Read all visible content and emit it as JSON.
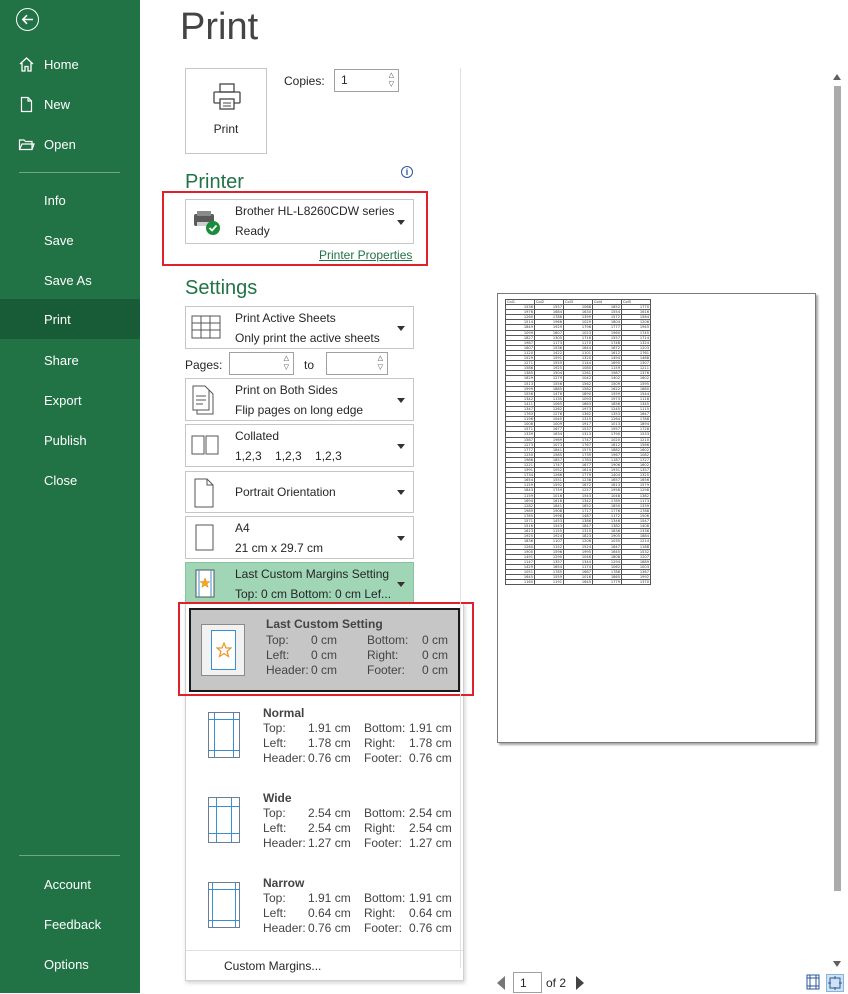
{
  "sidebar": {
    "back_label": "Back",
    "items": [
      {
        "label": "Home",
        "icon": "home-icon"
      },
      {
        "label": "New",
        "icon": "new-document-icon"
      },
      {
        "label": "Open",
        "icon": "open-folder-icon"
      },
      {
        "label": "Info"
      },
      {
        "label": "Save"
      },
      {
        "label": "Save As"
      },
      {
        "label": "Print",
        "selected": true
      },
      {
        "label": "Share"
      },
      {
        "label": "Export"
      },
      {
        "label": "Publish"
      },
      {
        "label": "Close"
      }
    ],
    "bottom_items": [
      {
        "label": "Account"
      },
      {
        "label": "Feedback"
      },
      {
        "label": "Options"
      }
    ],
    "color": "#217346",
    "selected_color": "#185c37"
  },
  "page_title": "Print",
  "print_button": {
    "label": "Print",
    "icon": "printer-icon"
  },
  "copies": {
    "label": "Copies:",
    "value": "1"
  },
  "printer": {
    "heading": "Printer",
    "name": "Brother HL-L8260CDW series",
    "status": "Ready",
    "properties_link": "Printer Properties",
    "info_icon": "info-icon"
  },
  "settings": {
    "heading": "Settings",
    "sheets": {
      "title": "Print Active Sheets",
      "subtitle": "Only print the active sheets"
    },
    "pages": {
      "label": "Pages:",
      "to_label": "to",
      "from_value": "",
      "to_value": ""
    },
    "sides": {
      "title": "Print on Both Sides",
      "subtitle": "Flip pages on long edge"
    },
    "collation": {
      "title": "Collated",
      "subtitle": "1,2,3    1,2,3    1,2,3"
    },
    "orientation": {
      "title": "Portrait Orientation"
    },
    "paper": {
      "title": "A4",
      "subtitle": "21 cm x 29.7 cm"
    },
    "margins": {
      "title": "Last Custom Margins Setting",
      "subtitle": "Top: 0 cm Bottom: 0 cm Lef..."
    }
  },
  "margins_menu": {
    "options": [
      {
        "name": "Last Custom Setting",
        "top_label": "Top:",
        "top": "0 cm",
        "bottom_label": "Bottom:",
        "bottom": "0 cm",
        "left_label": "Left:",
        "left": "0 cm",
        "right_label": "Right:",
        "right": "0 cm",
        "header_label": "Header:",
        "header": "0 cm",
        "footer_label": "Footer:",
        "footer": "0 cm",
        "selected": true
      },
      {
        "name": "Normal",
        "top_label": "Top:",
        "top": "1.91 cm",
        "bottom_label": "Bottom:",
        "bottom": "1.91 cm",
        "left_label": "Left:",
        "left": "1.78 cm",
        "right_label": "Right:",
        "right": "1.78 cm",
        "header_label": "Header:",
        "header": "0.76 cm",
        "footer_label": "Footer:",
        "footer": "0.76 cm"
      },
      {
        "name": "Wide",
        "top_label": "Top:",
        "top": "2.54 cm",
        "bottom_label": "Bottom:",
        "bottom": "2.54 cm",
        "left_label": "Left:",
        "left": "2.54 cm",
        "right_label": "Right:",
        "right": "2.54 cm",
        "header_label": "Header:",
        "header": "1.27 cm",
        "footer_label": "Footer:",
        "footer": "1.27 cm"
      },
      {
        "name": "Narrow",
        "top_label": "Top:",
        "top": "1.91 cm",
        "bottom_label": "Bottom:",
        "bottom": "1.91 cm",
        "left_label": "Left:",
        "left": "0.64 cm",
        "right_label": "Right:",
        "right": "0.64 cm",
        "header_label": "Header:",
        "header": "0.76 cm",
        "footer_label": "Footer:",
        "footer": "0.76 cm"
      }
    ],
    "custom_margins_label": "Custom Margins..."
  },
  "preview": {
    "columns": [
      "Col1",
      "Col2",
      "Col3",
      "Col4",
      "Col5"
    ],
    "rows": [
      [
        "1536",
        "1557",
        "1068",
        "1852",
        "1770"
      ],
      [
        "1976",
        "1684",
        "1630",
        "1554",
        "1616"
      ],
      [
        "1260",
        "1788",
        "1399",
        "1572",
        "1584"
      ],
      [
        "1514",
        "1966",
        "1029",
        "1804",
        "1206"
      ],
      [
        "1849",
        "1929",
        "1796",
        "1777",
        "1945"
      ],
      [
        "1099",
        "1807",
        "1023",
        "1960",
        "1745"
      ],
      [
        "1827",
        "1305",
        "1716",
        "1557",
        "1714"
      ],
      [
        "1987",
        "1173",
        "1170",
        "1748",
        "1324"
      ],
      [
        "1607",
        "1536",
        "1644",
        "1672",
        "1203"
      ],
      [
        "1120",
        "1422",
        "1101",
        "1612",
        "1761"
      ],
      [
        "1529",
        "1591",
        "1320",
        "1494",
        "1488"
      ],
      [
        "1271",
        "1555",
        "1144",
        "1695",
        "1307"
      ],
      [
        "1586",
        "1925",
        "1080",
        "1159",
        "1211"
      ],
      [
        "1385",
        "1504",
        "1261",
        "1987",
        "1376"
      ],
      [
        "1829",
        "1279",
        "1042",
        "1402",
        "1602"
      ],
      [
        "1513",
        "1556",
        "1562",
        "1509",
        "1595"
      ],
      [
        "1999",
        "1885",
        "1582",
        "1622",
        "1680"
      ],
      [
        "1556",
        "1476",
        "1890",
        "1559",
        "1544"
      ],
      [
        "1342",
        "1135",
        "1093",
        "1973",
        "1116"
      ],
      [
        "1411",
        "1065",
        "1663",
        "1856",
        "1345"
      ],
      [
        "1347",
        "1262",
        "1973",
        "1245",
        "1115"
      ],
      [
        "1763",
        "1276",
        "1362",
        "1353",
        "1647"
      ],
      [
        "1196",
        "1045",
        "1315",
        "1264",
        "1788"
      ],
      [
        "1008",
        "1009",
        "1917",
        "1013",
        "1894"
      ],
      [
        "1571",
        "1677",
        "1537",
        "1957",
        "1728"
      ],
      [
        "1339",
        "1634",
        "1313",
        "1790",
        "1533"
      ],
      [
        "1587",
        "1969",
        "1747",
        "1020",
        "1210"
      ],
      [
        "1273",
        "1073",
        "1767",
        "1812",
        "1566"
      ],
      [
        "1777",
        "1841",
        "1575",
        "1882",
        "1602"
      ],
      [
        "1250",
        "1585",
        "1739",
        "1967",
        "1082"
      ],
      [
        "1986",
        "1857",
        "1783",
        "1187",
        "1727"
      ],
      [
        "1221",
        "1747",
        "1677",
        "1906",
        "1602"
      ],
      [
        "1991",
        "1052",
        "1614",
        "1931",
        "1357"
      ],
      [
        "1734",
        "1266",
        "1779",
        "1404",
        "1325"
      ],
      [
        "1654",
        "1551",
        "1238",
        "1657",
        "1656"
      ],
      [
        "1159",
        "1592",
        "1672",
        "1813",
        "1579"
      ],
      [
        "1843",
        "1759",
        "1257",
        "1958",
        "1298"
      ],
      [
        "1159",
        "1016",
        "1543",
        "1048",
        "1382"
      ],
      [
        "1694",
        "1618",
        "1342",
        "1789",
        "1173"
      ],
      [
        "1282",
        "1841",
        "1852",
        "1850",
        "1339"
      ],
      [
        "1989",
        "1908",
        "1717",
        "1776",
        "1788"
      ],
      [
        "1765",
        "1998",
        "1487",
        "1172",
        "1506"
      ],
      [
        "1571",
        "1453",
        "1386",
        "1346",
        "1547"
      ],
      [
        "1516",
        "1543",
        "1847",
        "1382",
        "1408"
      ],
      [
        "1613",
        "1155",
        "1315",
        "1836",
        "1336"
      ],
      [
        "1925",
        "1924",
        "1823",
        "1905",
        "1884"
      ],
      [
        "1836",
        "1107",
        "1206",
        "1035",
        "1214"
      ],
      [
        "1260",
        "1152",
        "1524",
        "1647",
        "1188"
      ],
      [
        "1900",
        "1596",
        "1995",
        "1645",
        "1532"
      ],
      [
        "1491",
        "1290",
        "1046",
        "1808",
        "1207"
      ],
      [
        "1147",
        "1357",
        "1344",
        "1294",
        "1889"
      ],
      [
        "1429",
        "1654",
        "1174",
        "1062",
        "1003"
      ],
      [
        "1051",
        "1785",
        "1687",
        "1788",
        "1367"
      ],
      [
        "1645",
        "1559",
        "1016",
        "1865",
        "1992"
      ],
      [
        "1160",
        "1191",
        "1645",
        "1779",
        "1370"
      ]
    ],
    "current_page": "1",
    "of_label": "of 2",
    "show_margins_icon": "show-margins-icon",
    "zoom_to_page_icon": "zoom-to-page-icon"
  }
}
